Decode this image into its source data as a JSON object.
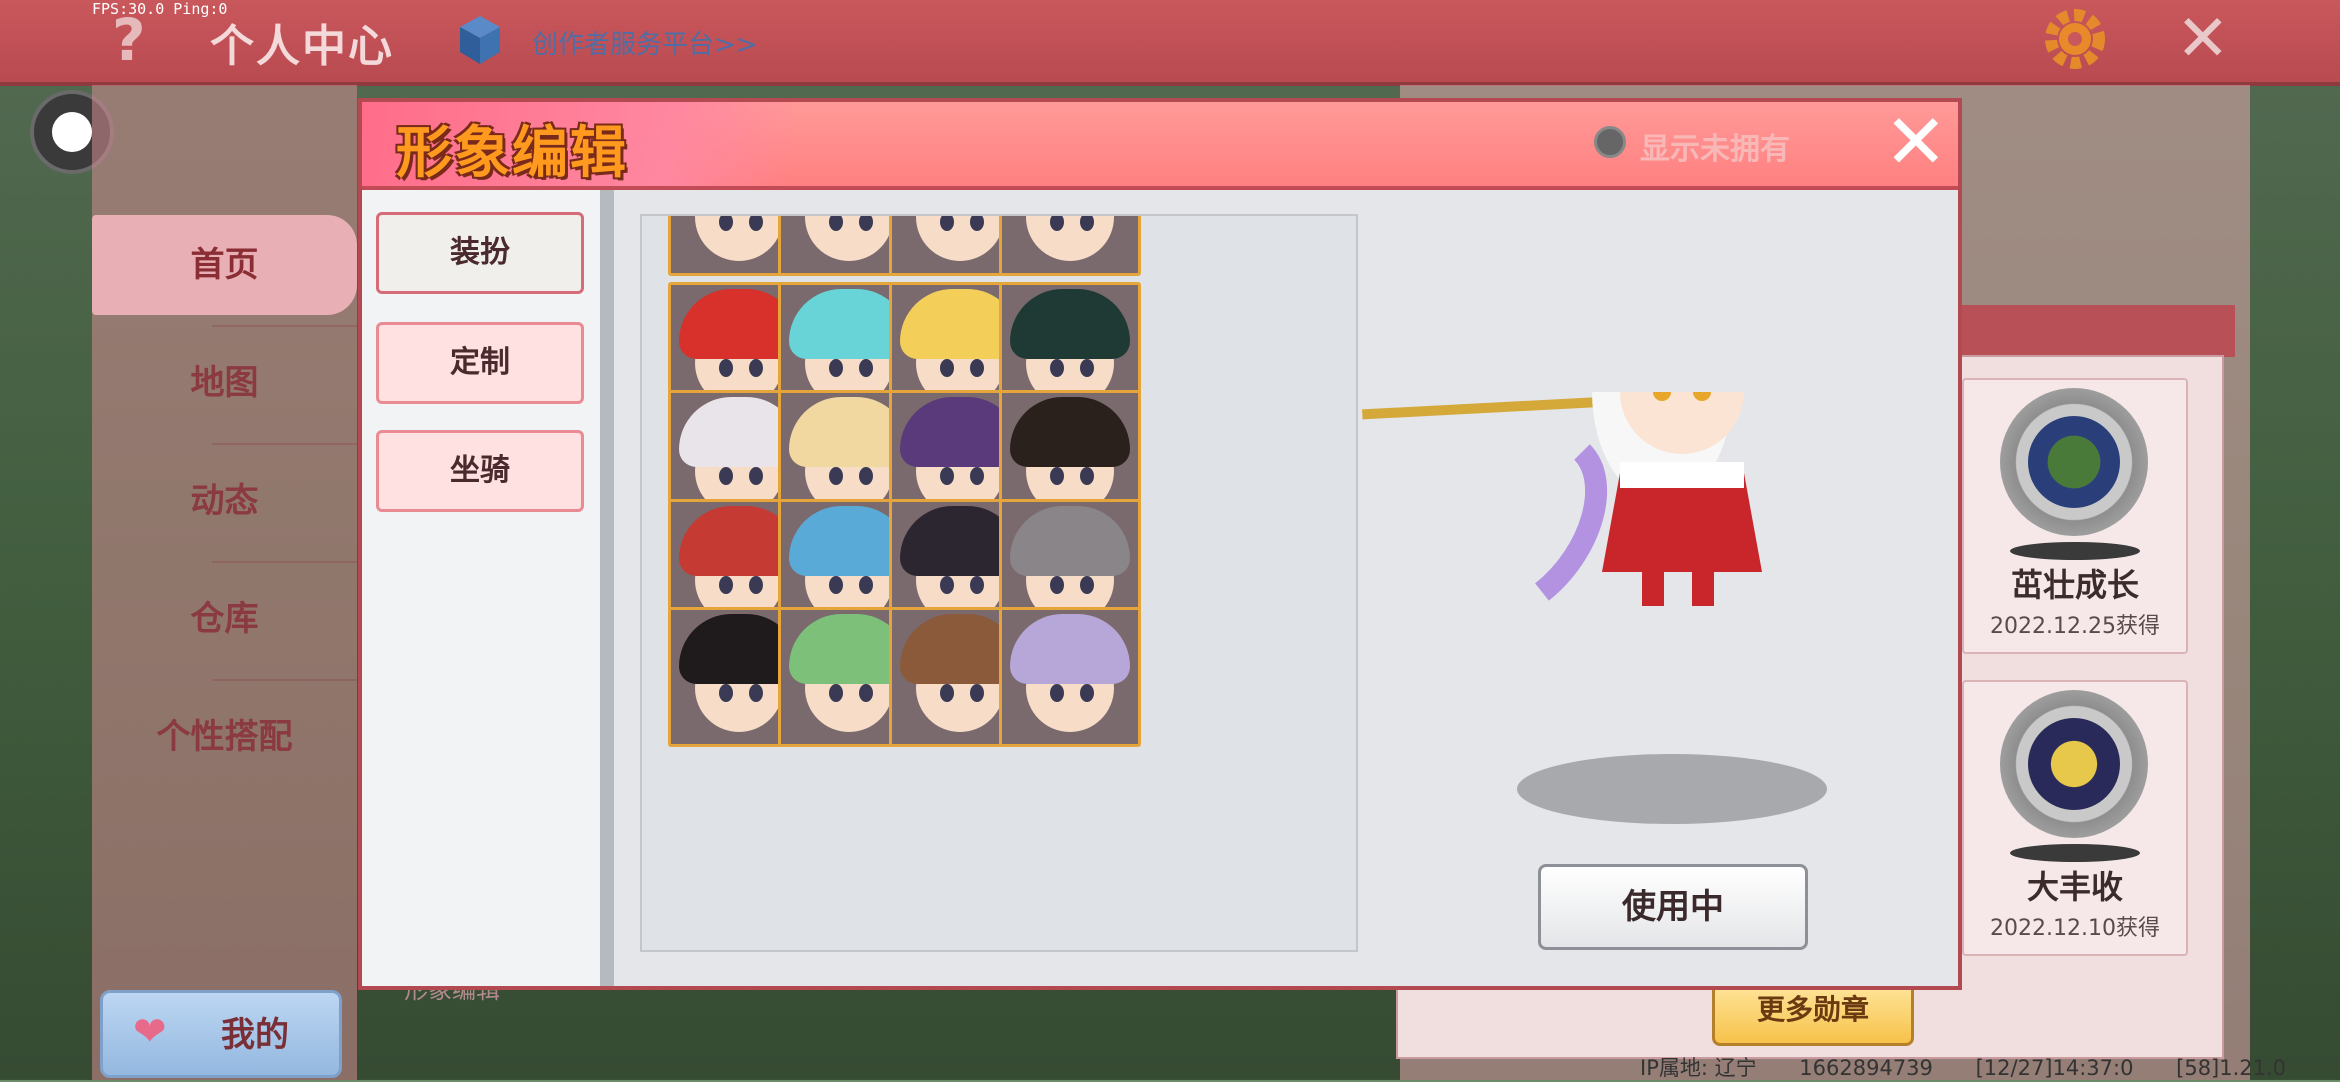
{
  "status": {
    "fps": "FPS:30.0  Ping:0"
  },
  "header": {
    "help": "?",
    "title": "个人中心",
    "creator_link": "创作者服务平台>>",
    "close": "✕"
  },
  "nav": {
    "items": [
      {
        "label": "首页",
        "active": true
      },
      {
        "label": "地图"
      },
      {
        "label": "动态"
      },
      {
        "label": "仓库"
      },
      {
        "label": "个性搭配"
      }
    ],
    "mine": "我的"
  },
  "dialog": {
    "title": "形象编辑",
    "show_unowned": "显示未拥有",
    "close": "✕",
    "tabs": [
      {
        "label": "装扮",
        "selected": true
      },
      {
        "label": "定制"
      },
      {
        "label": "坐骑"
      }
    ],
    "use_button": "使用中"
  },
  "medals": [
    {
      "name": "茁壮成长",
      "date": "2022.12.25获得"
    },
    {
      "name": "大丰收",
      "date": "2022.12.10获得"
    }
  ],
  "more_medals": "更多勋章",
  "ghost_label": "形象编辑",
  "bottom_info": {
    "ip": "IP属地: 辽宁",
    "uid": "1662894739",
    "time": "[12/27]14:37:0",
    "extra": "[58]1.21.0"
  },
  "colors": {
    "topbar": "#c9585c",
    "dialog_header": "#ff8c8c",
    "cell_border": "#e6a53a",
    "medal_green": "#3f6d3a",
    "medal_gold": "#d8b33a"
  },
  "avatars": [
    {
      "hair": "#2e2a2e"
    },
    {
      "hair": "#d9577a"
    },
    {
      "hair": "#e9b36a"
    },
    {
      "hair": "#6a3a2a"
    },
    {
      "hair": "#d8302a"
    },
    {
      "hair": "#68d4d8"
    },
    {
      "hair": "#f3cf5a"
    },
    {
      "hair": "#1f3a34"
    },
    {
      "hair": "#e8e4ea"
    },
    {
      "hair": "#f0d8a0"
    },
    {
      "hair": "#5a3a7a"
    },
    {
      "hair": "#2a201c"
    },
    {
      "hair": "#c63a34"
    },
    {
      "hair": "#5aaad8"
    },
    {
      "hair": "#2c2630"
    },
    {
      "hair": "#8a8588"
    },
    {
      "hair": "#1f1a1c"
    },
    {
      "hair": "#7cc07a"
    },
    {
      "hair": "#8a5a3a"
    },
    {
      "hair": "#b7a6d8"
    }
  ]
}
